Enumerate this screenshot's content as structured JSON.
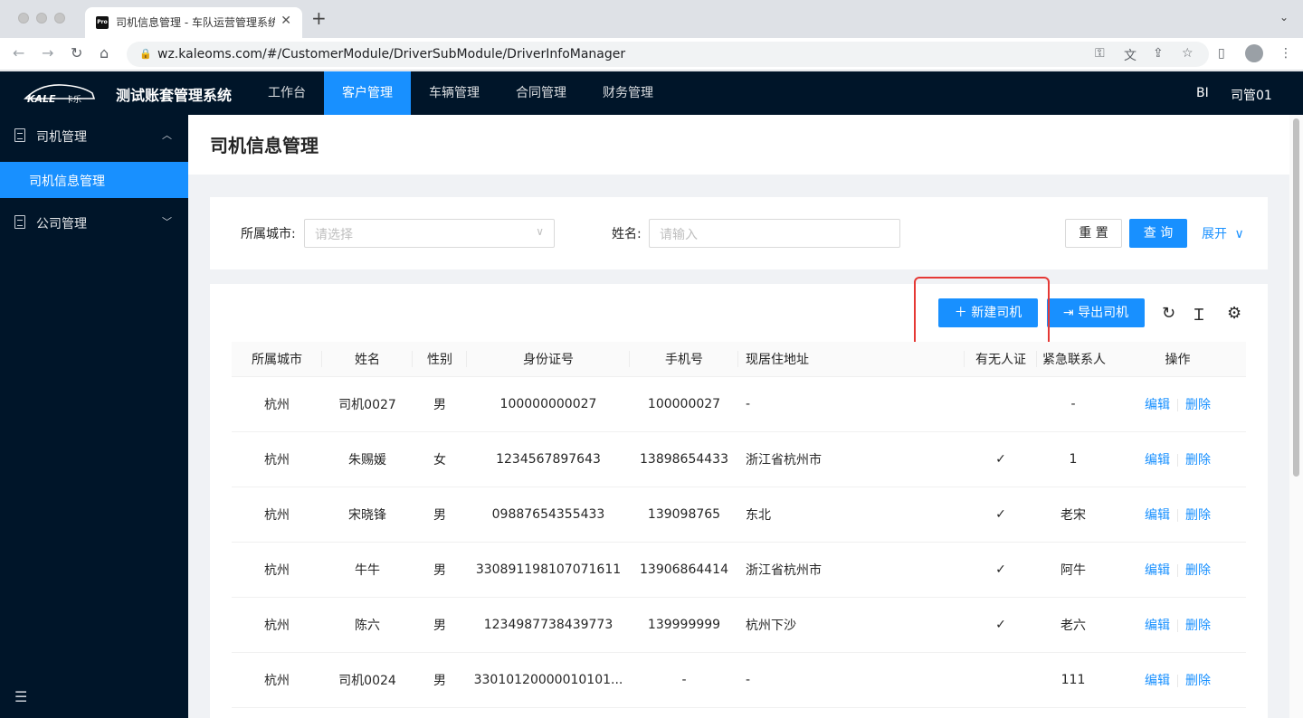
{
  "browser": {
    "tab_title": "司机信息管理 - 车队运营管理系统",
    "favicon_text": "Pro",
    "url": "wz.kaleoms.com/#/CustomerModule/DriverSubModule/DriverInfoManager"
  },
  "header": {
    "logo_text": "KALE卡乐",
    "app_name": "测试账套管理系统",
    "nav": [
      "工作台",
      "客户管理",
      "车辆管理",
      "合同管理",
      "财务管理"
    ],
    "active_nav": "客户管理",
    "right_links": [
      "BI",
      "司管01"
    ]
  },
  "sidebar": {
    "groups": [
      {
        "label": "司机管理",
        "expanded": true,
        "items": [
          "司机信息管理"
        ]
      },
      {
        "label": "公司管理",
        "expanded": false,
        "items": []
      }
    ],
    "active_item": "司机信息管理"
  },
  "page": {
    "title": "司机信息管理"
  },
  "search": {
    "city_label": "所属城市:",
    "city_placeholder": "请选择",
    "name_label": "姓名:",
    "name_placeholder": "请输入",
    "reset": "重 置",
    "query": "查 询",
    "expand": "展开"
  },
  "toolbar": {
    "new_driver": "新建司机",
    "export_driver": "导出司机"
  },
  "table": {
    "columns": [
      "所属城市",
      "姓名",
      "性别",
      "身份证号",
      "手机号",
      "现居住地址",
      "有无人证",
      "紧急联系人",
      "操作"
    ],
    "rows": [
      [
        "杭州",
        "司机0027",
        "男",
        "100000000027",
        "100000027",
        "-",
        "",
        "-"
      ],
      [
        "杭州",
        "朱赐媛",
        "女",
        "1234567897643",
        "13898654433",
        "浙江省杭州市",
        "✓",
        "1"
      ],
      [
        "杭州",
        "宋晓锋",
        "男",
        "09887654355433",
        "139098765",
        "东北",
        "✓",
        "老宋"
      ],
      [
        "杭州",
        "牛牛",
        "男",
        "330891198107071611",
        "13906864414",
        "浙江省杭州市",
        "✓",
        "阿牛"
      ],
      [
        "杭州",
        "陈六",
        "男",
        "1234987738439773",
        "139999999",
        "杭州下沙",
        "✓",
        "老六"
      ],
      [
        "杭州",
        "司机0024",
        "男",
        "33010120000010101...",
        "-",
        "-",
        "",
        "111"
      ]
    ],
    "actions": {
      "edit": "编辑",
      "delete": "删除"
    }
  },
  "colors": {
    "primary": "#1890ff",
    "header_bg": "#001529",
    "highlight": "#e53935"
  }
}
